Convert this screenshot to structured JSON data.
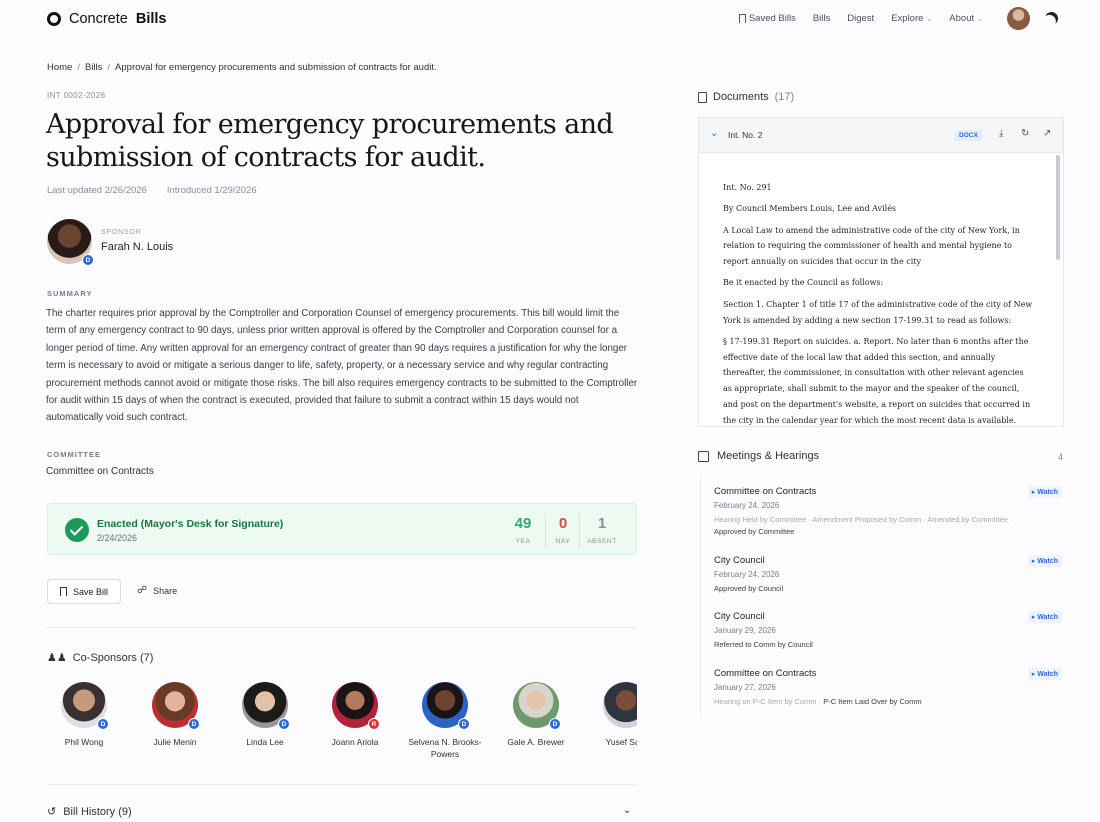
{
  "header": {
    "logo_text": "Concrete",
    "logo_bold": "Bills",
    "nav": [
      "Saved Bills",
      "Bills",
      "Digest",
      "Explore",
      "About"
    ]
  },
  "breadcrumb": {
    "home": "Home",
    "bills": "Bills",
    "current": "Approval for emergency procurements and submission of contracts for audit."
  },
  "bill": {
    "id": "INT 0002-2026",
    "title": "Approval for emergency procurements and submission of contracts for audit.",
    "last_updated": "Last updated 2/26/2026",
    "introduced": "Introduced 1/29/2026",
    "sponsor_label": "SPONSOR",
    "sponsor_name": "Farah N. Louis",
    "sponsor_party": "D",
    "summary_label": "SUMMARY",
    "summary": "The charter requires prior approval by the Comptroller and Corporation Counsel of emergency procurements. This bill would limit the term of any emergency contract to 90 days, unless prior written approval is offered by the Comptroller and Corporation counsel for a longer period of time. Any written approval for an emergency contract of greater than 90 days requires a justification for why the longer term is necessary to avoid or mitigate a serious danger to life, safety, property, or a necessary service and why regular contracting procurement methods cannot avoid or mitigate those risks. The bill also requires emergency contracts to be submitted to the Comptroller for audit within 15 days of when the contract is executed, provided that failure to submit a contract within 15 days would not automatically void such contract.",
    "committee_label": "COMMITTEE",
    "committee": "Committee on Contracts"
  },
  "status": {
    "title": "Enacted (Mayor's Desk for Signature)",
    "date": "2/24/2026",
    "yea": "49",
    "yea_label": "YEA",
    "nay": "0",
    "nay_label": "NAY",
    "absent": "1",
    "absent_label": "ABSENT",
    "colors": {
      "yea": "#1c9a5a",
      "nay": "#d73535",
      "absent": "#8a8f98"
    }
  },
  "actions": {
    "save": "Save Bill",
    "share": "Share"
  },
  "cosponsors": {
    "heading": "Co-Sponsors (7)",
    "items": [
      {
        "name": "Phil Wong",
        "party": "D"
      },
      {
        "name": "Julie Menin",
        "party": "D"
      },
      {
        "name": "Linda Lee",
        "party": "D"
      },
      {
        "name": "Joann Ariola",
        "party": "R"
      },
      {
        "name": "Selvena N. Brooks-Powers",
        "party": "D"
      },
      {
        "name": "Gale A. Brewer",
        "party": "D"
      },
      {
        "name": "Yusef Sala",
        "party": ""
      }
    ]
  },
  "history": {
    "heading": "Bill History (9)"
  },
  "documents": {
    "heading": "Documents",
    "count": "(17)",
    "selected": "Int. No. 2",
    "format": "DOCX",
    "paragraphs": [
      "Int. No. 291",
      "By Council Members Louis, Lee and Avilés",
      "A Local Law to amend the administrative code of the city of New York, in relation to requiring the commissioner of health and mental hygiene to report annually on suicides that occur in the city",
      "Be it enacted by the Council as follows:",
      "Section 1. Chapter 1 of title 17 of the administrative code of the city of New York is amended by adding a new section 17-199.31 to read as follows:",
      "§ 17-199.31 Report on suicides. a. Report. No later than 6 months after the effective date of the local law that added this section, and annually thereafter, the commissioner, in consultation with other relevant agencies as appropriate, shall submit to the mayor and the speaker of the council, and post on the department's website, a report on suicides that occurred in the city in the calendar year for which the most recent data is available."
    ]
  },
  "meetings": {
    "heading": "Meetings & Hearings",
    "count": "4",
    "watch_label": "Watch",
    "items": [
      {
        "title": "Committee on Contracts",
        "date": "February 24, 2026",
        "actions_light": "Hearing Held by Committee · Amendment Proposed by Comm · Amended by Committee ·",
        "actions_dark": "",
        "line2": "Approved by Committee"
      },
      {
        "title": "City Council",
        "date": "February 24, 2026",
        "actions_light": "",
        "actions_dark": "Approved by Council",
        "line2": ""
      },
      {
        "title": "City Council",
        "date": "January 29, 2026",
        "actions_light": "",
        "actions_dark": "Referred to Comm by Council",
        "line2": ""
      },
      {
        "title": "Committee on Contracts",
        "date": "January 27, 2026",
        "actions_light": "Hearing on P-C Item by Comm ·",
        "actions_dark": " P-C Item Laid Over by Comm",
        "line2": ""
      }
    ]
  }
}
